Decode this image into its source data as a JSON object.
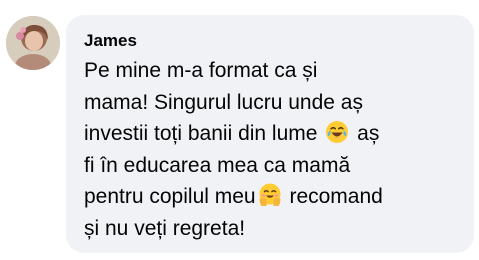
{
  "comment": {
    "author": "James",
    "lines": [
      "Pe mine m-a format ca și",
      "mama! Singurul lucru unde aș",
      "investii toți banii din lume",
      "aș",
      "fi în educarea mea ca mamă",
      "pentru copilul meu",
      "recomand",
      "și nu veți regreta!"
    ],
    "emojis": {
      "first": "face-with-tears-of-joy-icon",
      "second": "smiling-face-with-open-hands-icon"
    }
  }
}
